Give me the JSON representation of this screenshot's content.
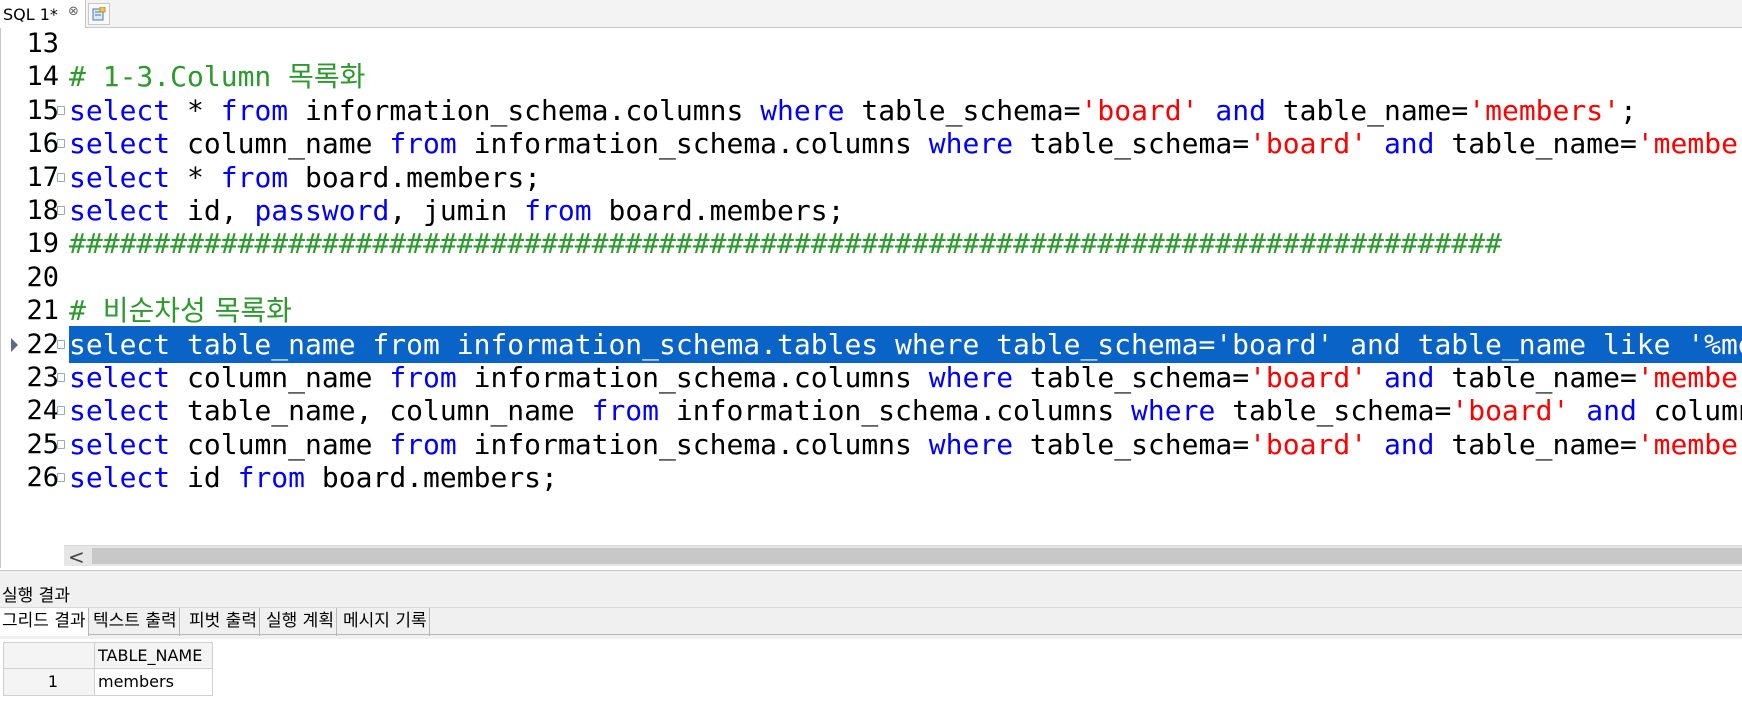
{
  "tab": {
    "label": "SQL 1*",
    "close_glyph": "⊗",
    "new_tab_icon": "new-query-icon"
  },
  "editor": {
    "colors": {
      "keyword": "#0000ff",
      "string": "#ff0000",
      "comment": "#2d9a2d",
      "selection": "#0a64c8"
    },
    "lines": [
      {
        "num": "13",
        "segments": []
      },
      {
        "num": "14",
        "segments": [
          {
            "t": "cmt",
            "v": "# 1-3.Column "
          },
          {
            "t": "cmt ko",
            "v": "목록화"
          }
        ]
      },
      {
        "num": "15",
        "segments": [
          {
            "t": "kw",
            "v": "select"
          },
          {
            "t": "txt",
            "v": " * "
          },
          {
            "t": "kw",
            "v": "from"
          },
          {
            "t": "txt",
            "v": " information_schema.columns "
          },
          {
            "t": "kw",
            "v": "where"
          },
          {
            "t": "txt",
            "v": " table_schema="
          },
          {
            "t": "str",
            "v": "'board'"
          },
          {
            "t": "txt",
            "v": " "
          },
          {
            "t": "kw",
            "v": "and"
          },
          {
            "t": "txt",
            "v": " table_name="
          },
          {
            "t": "str",
            "v": "'members'"
          },
          {
            "t": "txt",
            "v": ";"
          }
        ]
      },
      {
        "num": "16",
        "segments": [
          {
            "t": "kw",
            "v": "select"
          },
          {
            "t": "txt",
            "v": " column_name "
          },
          {
            "t": "kw",
            "v": "from"
          },
          {
            "t": "txt",
            "v": " information_schema.columns "
          },
          {
            "t": "kw",
            "v": "where"
          },
          {
            "t": "txt",
            "v": " table_schema="
          },
          {
            "t": "str",
            "v": "'board'"
          },
          {
            "t": "txt",
            "v": " "
          },
          {
            "t": "kw",
            "v": "and"
          },
          {
            "t": "txt",
            "v": " table_name="
          },
          {
            "t": "str",
            "v": "'members'"
          },
          {
            "t": "txt",
            "v": ";"
          }
        ]
      },
      {
        "num": "17",
        "segments": [
          {
            "t": "kw",
            "v": "select"
          },
          {
            "t": "txt",
            "v": " * "
          },
          {
            "t": "kw",
            "v": "from"
          },
          {
            "t": "txt",
            "v": " board.members;"
          }
        ]
      },
      {
        "num": "18",
        "segments": [
          {
            "t": "kw",
            "v": "select"
          },
          {
            "t": "txt",
            "v": " id, "
          },
          {
            "t": "kw",
            "v": "password"
          },
          {
            "t": "txt",
            "v": ", jumin "
          },
          {
            "t": "kw",
            "v": "from"
          },
          {
            "t": "txt",
            "v": " board.members;"
          }
        ]
      },
      {
        "num": "19",
        "segments": [
          {
            "t": "cmt",
            "v": "#####################################################################################"
          }
        ]
      },
      {
        "num": "20",
        "segments": []
      },
      {
        "num": "21",
        "segments": [
          {
            "t": "cmt",
            "v": "# "
          },
          {
            "t": "cmt ko",
            "v": "비순차성 목록화"
          }
        ]
      },
      {
        "num": "22",
        "selected": true,
        "segments": [
          {
            "t": "txt",
            "v": "select table_name from information_schema.tables where table_schema='board' and table_name like '%mem%';"
          }
        ]
      },
      {
        "num": "23",
        "segments": [
          {
            "t": "kw",
            "v": "select"
          },
          {
            "t": "txt",
            "v": " column_name "
          },
          {
            "t": "kw",
            "v": "from"
          },
          {
            "t": "txt",
            "v": " information_schema.columns "
          },
          {
            "t": "kw",
            "v": "where"
          },
          {
            "t": "txt",
            "v": " table_schema="
          },
          {
            "t": "str",
            "v": "'board'"
          },
          {
            "t": "txt",
            "v": " "
          },
          {
            "t": "kw",
            "v": "and"
          },
          {
            "t": "txt",
            "v": " table_name="
          },
          {
            "t": "str",
            "v": "'members'"
          },
          {
            "t": "txt",
            "v": ";"
          }
        ]
      },
      {
        "num": "24",
        "segments": [
          {
            "t": "kw",
            "v": "select"
          },
          {
            "t": "txt",
            "v": " table_name, column_name "
          },
          {
            "t": "kw",
            "v": "from"
          },
          {
            "t": "txt",
            "v": " information_schema.columns "
          },
          {
            "t": "kw",
            "v": "where"
          },
          {
            "t": "txt",
            "v": " table_schema="
          },
          {
            "t": "str",
            "v": "'board'"
          },
          {
            "t": "txt",
            "v": " "
          },
          {
            "t": "kw",
            "v": "and"
          },
          {
            "t": "txt",
            "v": " column_name"
          }
        ]
      },
      {
        "num": "25",
        "segments": [
          {
            "t": "kw",
            "v": "select"
          },
          {
            "t": "txt",
            "v": " column_name "
          },
          {
            "t": "kw",
            "v": "from"
          },
          {
            "t": "txt",
            "v": " information_schema.columns "
          },
          {
            "t": "kw",
            "v": "where"
          },
          {
            "t": "txt",
            "v": " table_schema="
          },
          {
            "t": "str",
            "v": "'board'"
          },
          {
            "t": "txt",
            "v": " "
          },
          {
            "t": "kw",
            "v": "and"
          },
          {
            "t": "txt",
            "v": " table_name="
          },
          {
            "t": "str",
            "v": "'members'"
          },
          {
            "t": "txt",
            "v": ";"
          }
        ]
      },
      {
        "num": "26",
        "segments": [
          {
            "t": "kw",
            "v": "select"
          },
          {
            "t": "txt",
            "v": " id "
          },
          {
            "t": "kw",
            "v": "from"
          },
          {
            "t": "txt",
            "v": " board.members;"
          }
        ]
      }
    ]
  },
  "scrollbar": {
    "left_glyph": "<"
  },
  "results": {
    "title": "실행 결과",
    "tabs": [
      "그리드 결과",
      "텍스트 출력",
      "피벗 출력",
      "실행 계획",
      "메시지 기록"
    ],
    "active_tab": 0,
    "grid": {
      "columns": [
        "TABLE_NAME"
      ],
      "rows": [
        {
          "num": "1",
          "cells": [
            "members"
          ]
        }
      ]
    }
  }
}
